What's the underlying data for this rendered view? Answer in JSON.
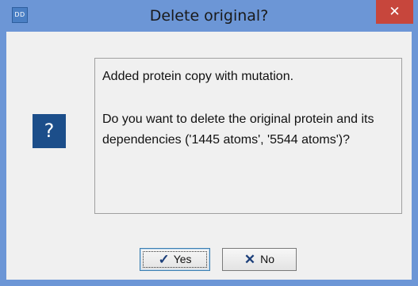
{
  "window": {
    "title": "Delete original?",
    "app_icon_text": "DD",
    "close_icon": "close-icon",
    "accent_color": "#6c96d6"
  },
  "dialog": {
    "icon": "question-icon",
    "icon_glyph": "?",
    "message_line1": "Added protein copy with mutation.",
    "message_line2": "Do you want to delete the original protein and its dependencies ('1445 atoms', '5544 atoms')?"
  },
  "buttons": {
    "yes_label": "Yes",
    "yes_icon": "check-icon",
    "no_label": "No",
    "no_icon": "x-icon"
  }
}
